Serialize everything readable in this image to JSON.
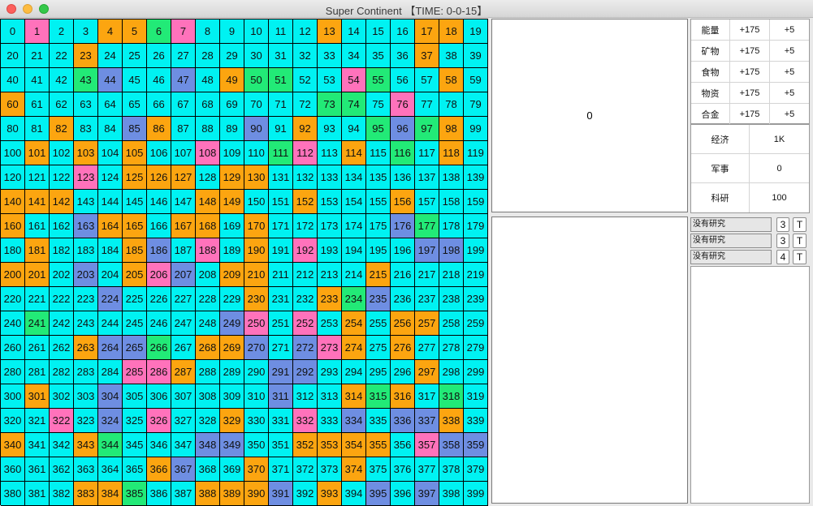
{
  "window": {
    "title": "Super Continent 【TIME: 0-0-15】"
  },
  "colors": {
    "c": "#00f2f2",
    "o": "#fca510",
    "p": "#ff72bb",
    "g": "#22ea77",
    "b": "#6e8ee2"
  },
  "grid": {
    "rows": [
      "cpccoogpcccccocccooc",
      "cccocccccccccccccocco",
      "cccgbccbcoggccpgccoc",
      "occccccccccccggcpccc",
      "ccoccbocccbcoccgbgoc",
      "cocococcpccgpcocgco",
      "cccpcooocooccccccccc",
      "ooocccccooccocccoccc",
      "occboocoococccccbgcc",
      "cocccobcpcocpccccbb",
      "oocbcopbcooccccoccc",
      "ccccbcccccoccogbcc",
      "cgcccccccbpcpcocooc",
      "cccobbgcoobcbpococcc",
      "cccccppocccbbccccocc",
      "coccbccccccbccogocg",
      "ccpcbcpccoccpcbcbbo",
      "occogcccbbccoooocpbbo",
      "ccccccobccocccoccccc",
      "cccoogccooobcocbcbcc"
    ]
  },
  "main_panel": {
    "value": "0"
  },
  "resources": [
    {
      "name": "能量",
      "amount": "+175",
      "rate": "+5"
    },
    {
      "name": "矿物",
      "amount": "+175",
      "rate": "+5"
    },
    {
      "name": "食物",
      "amount": "+175",
      "rate": "+5"
    },
    {
      "name": "物资",
      "amount": "+175",
      "rate": "+5"
    },
    {
      "name": "合金",
      "amount": "+175",
      "rate": "+5"
    }
  ],
  "stats": [
    {
      "name": "经济",
      "value": "1K"
    },
    {
      "name": "军事",
      "value": "0"
    },
    {
      "name": "科研",
      "value": "100"
    }
  ],
  "research": [
    {
      "label": "没有研究",
      "count": "3",
      "button": "T"
    },
    {
      "label": "没有研究",
      "count": "3",
      "button": "T"
    },
    {
      "label": "没有研究",
      "count": "4",
      "button": "T"
    }
  ]
}
